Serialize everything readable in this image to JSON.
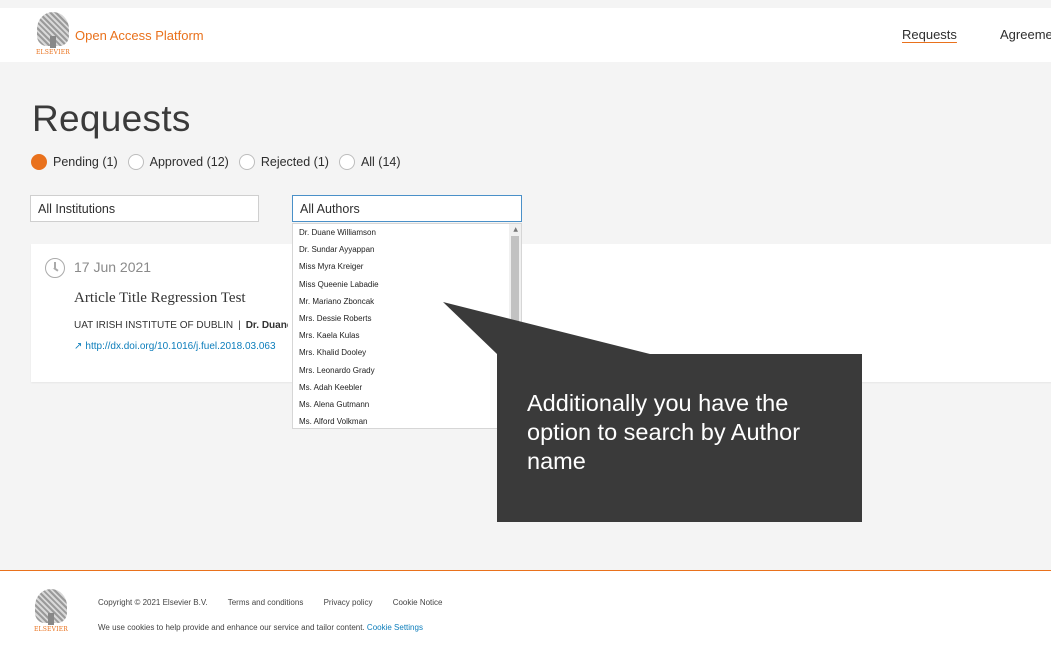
{
  "header": {
    "brand": "ELSEVIER",
    "app_title": "Open Access Platform",
    "nav": {
      "requests": "Requests",
      "agreements": "Agreeme"
    }
  },
  "page": {
    "title": "Requests"
  },
  "status_filters": [
    {
      "label": "Pending (1)",
      "selected": true
    },
    {
      "label": "Approved (12)",
      "selected": false
    },
    {
      "label": "Rejected (1)",
      "selected": false
    },
    {
      "label": "All (14)",
      "selected": false
    }
  ],
  "institution_select": {
    "value": "All Institutions"
  },
  "author_select": {
    "value": "All Authors"
  },
  "author_options": [
    "Dr. Duane Williamson",
    "Dr. Sundar Ayyappan",
    "Miss Myra Kreiger",
    "Miss Queenie Labadie",
    "Mr. Mariano Zboncak",
    "Mrs. Dessie Roberts",
    "Mrs. Kaela Kulas",
    "Mrs. Khalid Dooley",
    "Mrs. Leonardo Grady",
    "Ms. Adah Keebler",
    "Ms. Alena Gutmann",
    "Ms. Alford Volkman"
  ],
  "request_card": {
    "date": "17 Jun 2021",
    "title": "Article Title Regression Test",
    "institution": "UAT IRISH INSTITUTE OF DUBLIN",
    "separator": "|",
    "author": "Dr. Duane",
    "doi_url": "http://dx.doi.org/10.1016/j.fuel.2018.03.063"
  },
  "tooltip": {
    "text": "Additionally you have the option to search by Author name"
  },
  "footer": {
    "copyright": "Copyright © 2021 Elsevier B.V.",
    "terms": "Terms and conditions",
    "privacy": "Privacy policy",
    "cookie_notice": "Cookie Notice",
    "cookie_text": "We use cookies to help provide and enhance our service and tailor content.",
    "cookie_settings": "Cookie Settings"
  },
  "colors": {
    "accent": "#e9711c",
    "link": "#0c7dbb",
    "tooltip_bg": "#3a3a3a"
  },
  "icons": {
    "clock": "clock-icon",
    "external_link": "external-link-icon"
  }
}
